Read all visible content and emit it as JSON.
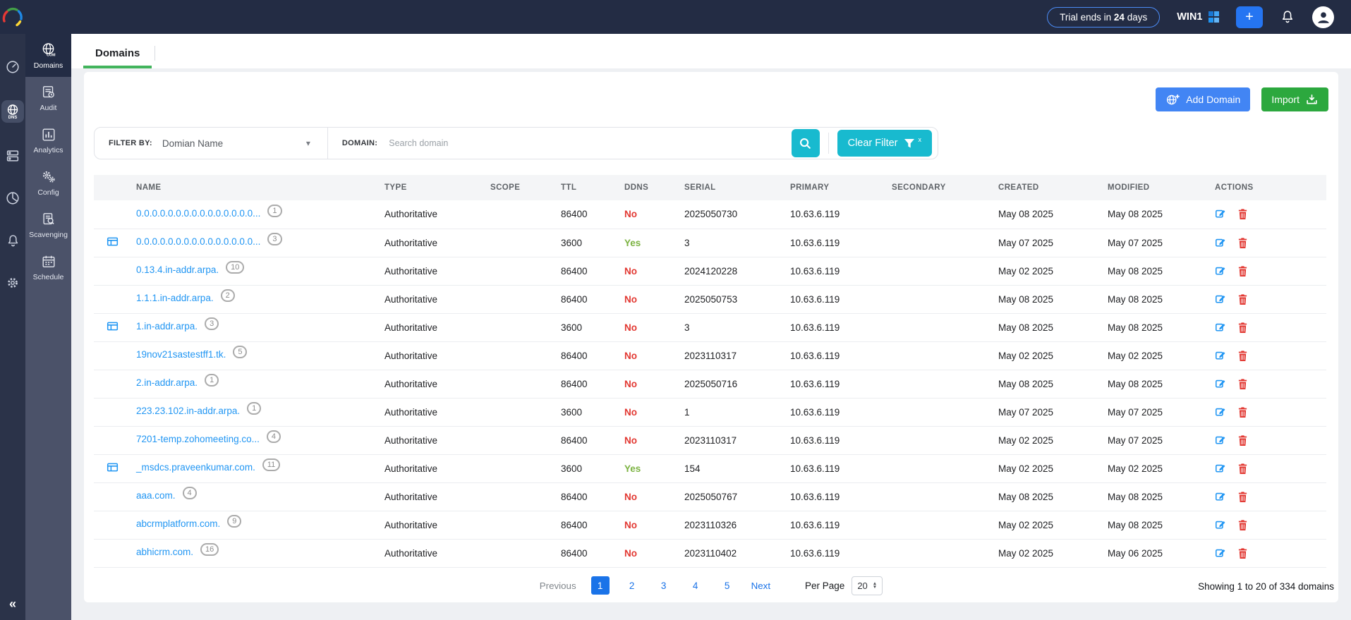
{
  "topbar": {
    "trial_prefix": "Trial ends in",
    "trial_days": "24",
    "trial_suffix": "days",
    "server_name": "WIN1",
    "add_label": "+"
  },
  "sidebar": {
    "collapse": "«",
    "items": [
      {
        "label": "Domains",
        "active": true
      },
      {
        "label": "Audit",
        "active": false
      },
      {
        "label": "Analytics",
        "active": false
      },
      {
        "label": "Config",
        "active": false
      },
      {
        "label": "Scavenging",
        "active": false
      },
      {
        "label": "Schedule",
        "active": false
      }
    ]
  },
  "tab": {
    "label": "Domains"
  },
  "actions": {
    "add_domain": "Add Domain",
    "import": "Import"
  },
  "filter": {
    "filter_by_label": "FILTER BY:",
    "filter_by_value": "Domian Name",
    "caret": "▾",
    "domain_label": "DOMAIN:",
    "search_placeholder": "Search domain",
    "clear_filter_label": "Clear Filter",
    "clear_filter_sup": "x"
  },
  "table": {
    "columns": [
      "NAME",
      "TYPE",
      "SCOPE",
      "TTL",
      "DDNS",
      "SERIAL",
      "PRIMARY",
      "SECONDARY",
      "CREATED",
      "MODIFIED",
      "ACTIONS"
    ],
    "rows": [
      {
        "name": "0.0.0.0.0.0.0.0.0.0.0.0.0.0.0...",
        "records": "1",
        "ad_integrated": false,
        "type": "Authoritative",
        "scope": "",
        "ttl": "86400",
        "ddns": "No",
        "serial": "2025050730",
        "primary": "10.63.6.119",
        "secondary": "",
        "created": "May 08 2025",
        "modified": "May 08 2025"
      },
      {
        "name": "0.0.0.0.0.0.0.0.0.0.0.0.0.0.0...",
        "records": "3",
        "ad_integrated": true,
        "type": "Authoritative",
        "scope": "",
        "ttl": "3600",
        "ddns": "Yes",
        "serial": "3",
        "primary": "10.63.6.119",
        "secondary": "",
        "created": "May 07 2025",
        "modified": "May 07 2025"
      },
      {
        "name": "0.13.4.in-addr.arpa.",
        "records": "10",
        "ad_integrated": false,
        "type": "Authoritative",
        "scope": "",
        "ttl": "86400",
        "ddns": "No",
        "serial": "2024120228",
        "primary": "10.63.6.119",
        "secondary": "",
        "created": "May 02 2025",
        "modified": "May 08 2025"
      },
      {
        "name": "1.1.1.in-addr.arpa.",
        "records": "2",
        "ad_integrated": false,
        "type": "Authoritative",
        "scope": "",
        "ttl": "86400",
        "ddns": "No",
        "serial": "2025050753",
        "primary": "10.63.6.119",
        "secondary": "",
        "created": "May 08 2025",
        "modified": "May 08 2025"
      },
      {
        "name": "1.in-addr.arpa.",
        "records": "3",
        "ad_integrated": true,
        "type": "Authoritative",
        "scope": "",
        "ttl": "3600",
        "ddns": "No",
        "serial": "3",
        "primary": "10.63.6.119",
        "secondary": "",
        "created": "May 08 2025",
        "modified": "May 08 2025"
      },
      {
        "name": "19nov21sastestff1.tk.",
        "records": "5",
        "ad_integrated": false,
        "type": "Authoritative",
        "scope": "",
        "ttl": "86400",
        "ddns": "No",
        "serial": "2023110317",
        "primary": "10.63.6.119",
        "secondary": "",
        "created": "May 02 2025",
        "modified": "May 02 2025"
      },
      {
        "name": "2.in-addr.arpa.",
        "records": "1",
        "ad_integrated": false,
        "type": "Authoritative",
        "scope": "",
        "ttl": "86400",
        "ddns": "No",
        "serial": "2025050716",
        "primary": "10.63.6.119",
        "secondary": "",
        "created": "May 08 2025",
        "modified": "May 08 2025"
      },
      {
        "name": "223.23.102.in-addr.arpa.",
        "records": "1",
        "ad_integrated": false,
        "type": "Authoritative",
        "scope": "",
        "ttl": "3600",
        "ddns": "No",
        "serial": "1",
        "primary": "10.63.6.119",
        "secondary": "",
        "created": "May 07 2025",
        "modified": "May 07 2025"
      },
      {
        "name": "7201-temp.zohomeeting.co...",
        "records": "4",
        "ad_integrated": false,
        "type": "Authoritative",
        "scope": "",
        "ttl": "86400",
        "ddns": "No",
        "serial": "2023110317",
        "primary": "10.63.6.119",
        "secondary": "",
        "created": "May 02 2025",
        "modified": "May 07 2025"
      },
      {
        "name": "_msdcs.praveenkumar.com.",
        "records": "11",
        "ad_integrated": true,
        "type": "Authoritative",
        "scope": "",
        "ttl": "3600",
        "ddns": "Yes",
        "serial": "154",
        "primary": "10.63.6.119",
        "secondary": "",
        "created": "May 02 2025",
        "modified": "May 02 2025"
      },
      {
        "name": "aaa.com.",
        "records": "4",
        "ad_integrated": false,
        "type": "Authoritative",
        "scope": "",
        "ttl": "86400",
        "ddns": "No",
        "serial": "2025050767",
        "primary": "10.63.6.119",
        "secondary": "",
        "created": "May 08 2025",
        "modified": "May 08 2025"
      },
      {
        "name": "abcrmplatform.com.",
        "records": "9",
        "ad_integrated": false,
        "type": "Authoritative",
        "scope": "",
        "ttl": "86400",
        "ddns": "No",
        "serial": "2023110326",
        "primary": "10.63.6.119",
        "secondary": "",
        "created": "May 02 2025",
        "modified": "May 08 2025"
      },
      {
        "name": "abhicrm.com.",
        "records": "16",
        "ad_integrated": false,
        "type": "Authoritative",
        "scope": "",
        "ttl": "86400",
        "ddns": "No",
        "serial": "2023110402",
        "primary": "10.63.6.119",
        "secondary": "",
        "created": "May 02 2025",
        "modified": "May 06 2025"
      }
    ]
  },
  "pagination": {
    "previous": "Previous",
    "pages": [
      "1",
      "2",
      "3",
      "4",
      "5"
    ],
    "active_page": "1",
    "next": "Next",
    "per_page_label": "Per Page",
    "per_page_value": "20",
    "summary": "Showing 1 to 20 of 334 domains"
  },
  "colors": {
    "topbar_bg": "#232c44",
    "rail_bg": "#2b3349",
    "nav_bg": "#4b5269",
    "accent_blue": "#4285f4",
    "import_green": "#2ca83e",
    "cyan": "#18bacf",
    "link_blue": "#2196f3",
    "danger_red": "#e23731",
    "ddns_yes_green": "#7cb342",
    "tab_underline_green": "#42b45c",
    "active_page_blue": "#1a73e8"
  },
  "icons": [
    "logo-swirl",
    "windows-logo-icon",
    "plus-icon",
    "bell-icon",
    "user-avatar-icon",
    "gauge-icon",
    "dns-globe-icon",
    "server-icon",
    "pie-chart-icon",
    "gear-icon",
    "collapse-chevrons-icon",
    "domains-globe-icon",
    "audit-clipboard-icon",
    "analytics-bars-icon",
    "config-gears-icon",
    "scavenging-doc-search-icon",
    "schedule-calendar-icon",
    "add-domain-globe-icon",
    "import-download-icon",
    "search-icon",
    "clear-filter-funnel-icon",
    "ad-integrated-icon",
    "edit-icon",
    "delete-icon",
    "caret-down-icon",
    "per-page-stepper-icon"
  ]
}
